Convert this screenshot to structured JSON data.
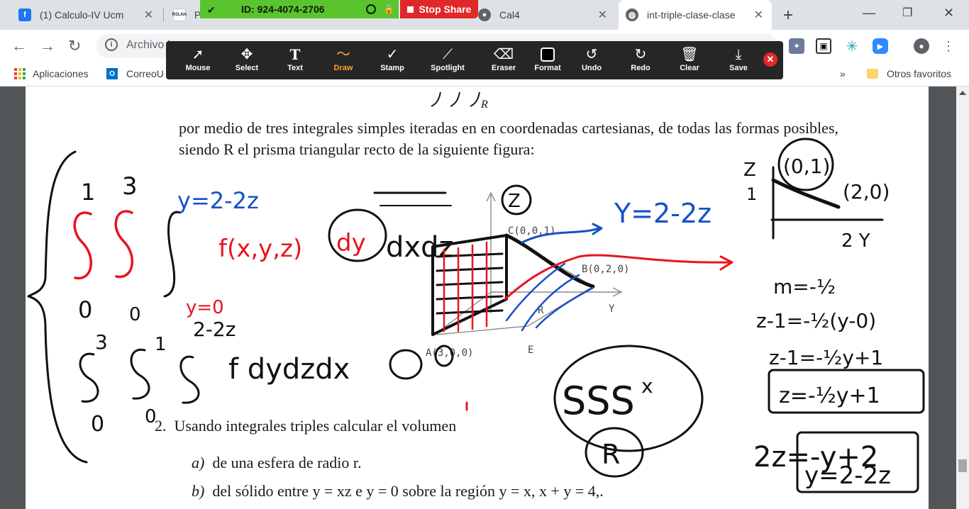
{
  "browser": {
    "tabs": [
      {
        "title": "(1) Calculo-IV Ucm",
        "icon": "facebook-icon"
      },
      {
        "title": "P",
        "icon": "site-icon"
      },
      {
        "title": "Cal4",
        "icon": "github-icon"
      },
      {
        "title": "int-triple-clase-clase",
        "icon": "globe-icon",
        "active": true
      }
    ],
    "address": "Archivo |",
    "bookmarks": {
      "apps": "Aplicaciones",
      "mail": "CorreoU",
      "more": "»",
      "others": "Otros favoritos"
    }
  },
  "zoom": {
    "meeting_id": "ID: 924-4074-2706",
    "stop_share": "Stop Share",
    "tools": [
      {
        "label": "Mouse",
        "icon": "cursor-arrow-icon"
      },
      {
        "label": "Select",
        "icon": "move-icon"
      },
      {
        "label": "Text",
        "icon": "text-icon",
        "glyph": "T"
      },
      {
        "label": "Draw",
        "icon": "wave-draw-icon",
        "active": true
      },
      {
        "label": "Stamp",
        "icon": "check-stamp-icon"
      },
      {
        "label": "Spotlight",
        "icon": "wand-icon"
      },
      {
        "label": "Eraser",
        "icon": "eraser-icon"
      },
      {
        "label": "Format",
        "icon": "format-swatch-icon"
      },
      {
        "label": "Undo",
        "icon": "undo-icon"
      },
      {
        "label": "Redo",
        "icon": "redo-icon"
      },
      {
        "label": "Clear",
        "icon": "trash-icon"
      },
      {
        "label": "Save",
        "icon": "download-save-icon"
      }
    ]
  },
  "pdf": {
    "intro_text": "por medio de tres integrales simples iteradas en en coordenadas cartesianas, de todas las formas posibles, siendo R el prisma triangular recto de la siguiente figura:",
    "figure_labels": {
      "axis_z": "Z",
      "axis_y": "Y",
      "point_c": "C(0,0,1)",
      "point_b": "B(0,2,0)",
      "point_a": "A(3,0,0)",
      "point_e": "E",
      "point_r": "R"
    },
    "q2_number": "2.",
    "q2_text": "Usando integrales triples calcular el volumen",
    "qa_label": "a)",
    "qa_text": "de una esfera de radio r.",
    "qb_label": "b)",
    "qb_text": "del sólido entre y = xz e y = 0 sobre la región y = x, x + y = 4,."
  },
  "colors": {
    "zoom_green": "#5ac42e",
    "stop_red": "#e02828",
    "ink_red": "#e8141e",
    "ink_blue": "#1450c8",
    "draw_active": "#f6a623"
  }
}
